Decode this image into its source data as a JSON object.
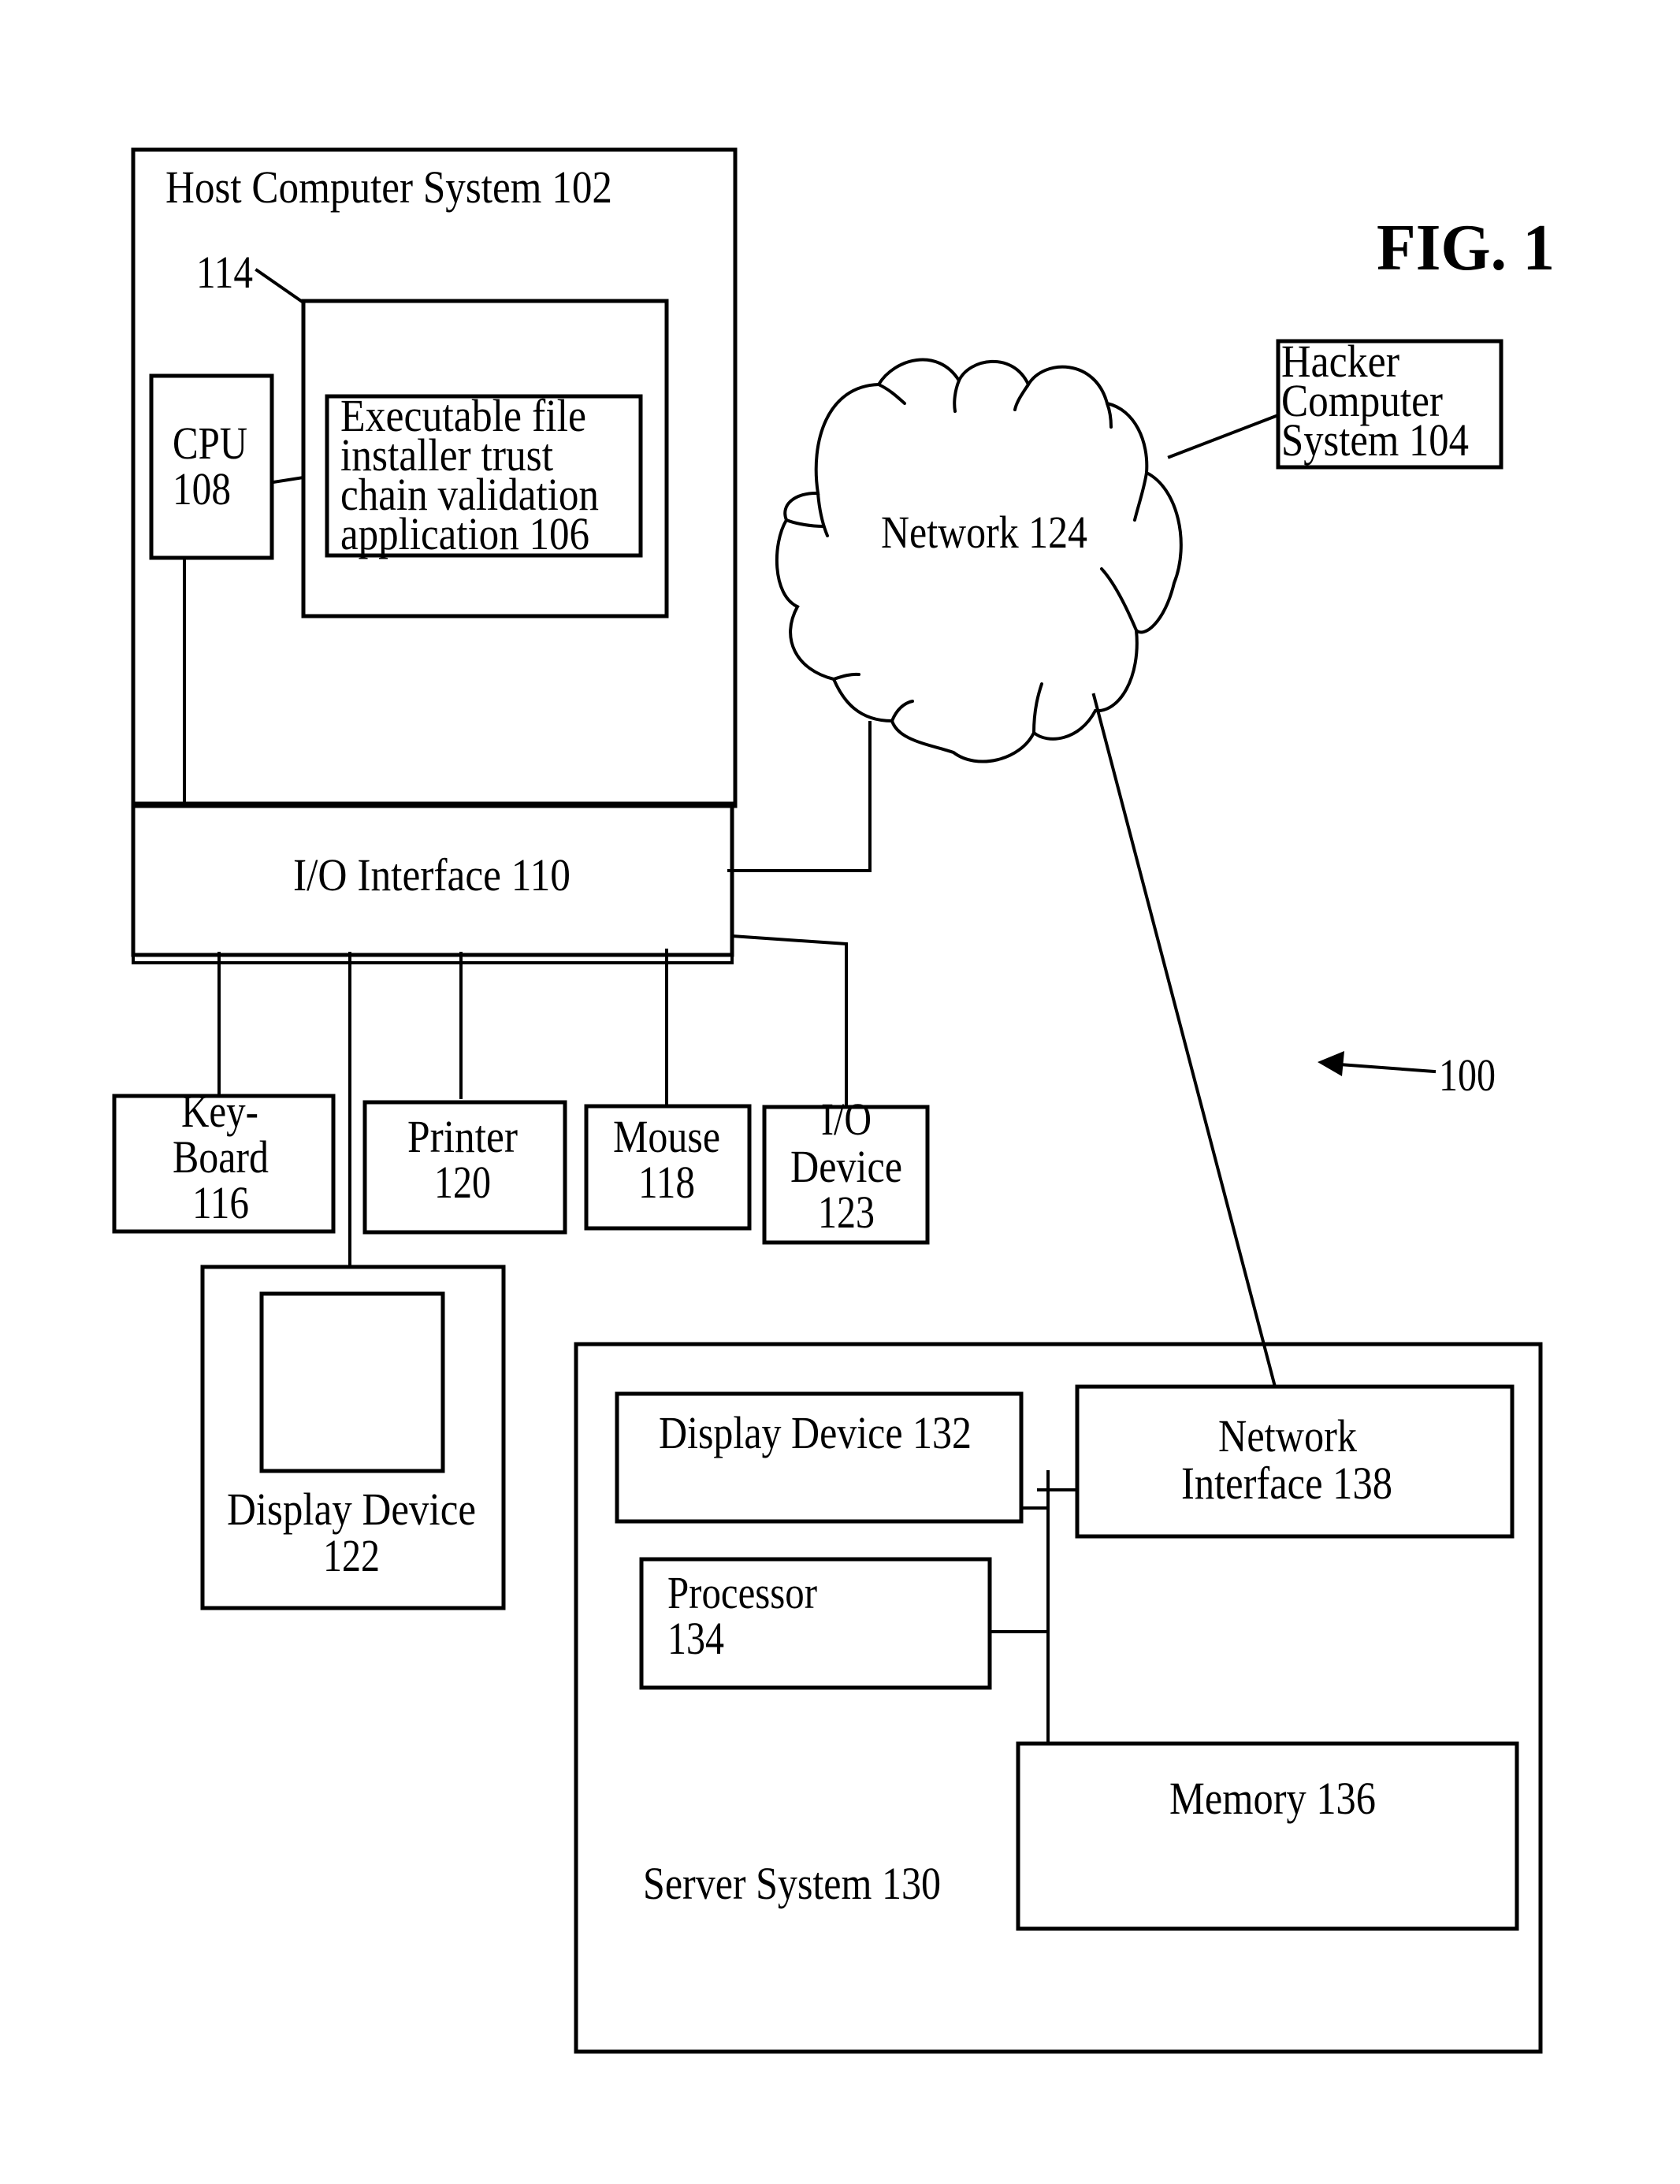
{
  "figure": {
    "title": "FIG. 1",
    "reference": "100"
  },
  "host": {
    "title": "Host Computer System 102",
    "memory_ref": "114",
    "cpu": [
      "CPU",
      "108"
    ],
    "application": [
      "Executable file",
      "installer trust",
      "chain validation",
      "application 106"
    ],
    "io_interface": "I/O Interface 110"
  },
  "peripherals": {
    "keyboard": [
      "Key-",
      "Board",
      "116"
    ],
    "printer": [
      "Printer",
      "120"
    ],
    "mouse": [
      "Mouse",
      "118"
    ],
    "io_device": [
      "I/O",
      "Device",
      "123"
    ],
    "display": [
      "Display Device",
      "122"
    ]
  },
  "network": {
    "label": "Network 124"
  },
  "hacker": {
    "label": [
      "Hacker",
      "Computer",
      "System 104"
    ]
  },
  "server": {
    "title": "Server System 130",
    "display": "Display Device 132",
    "processor": [
      "Processor",
      "134"
    ],
    "memory": "Memory 136",
    "network_interface": [
      "Network",
      "Interface 138"
    ]
  }
}
